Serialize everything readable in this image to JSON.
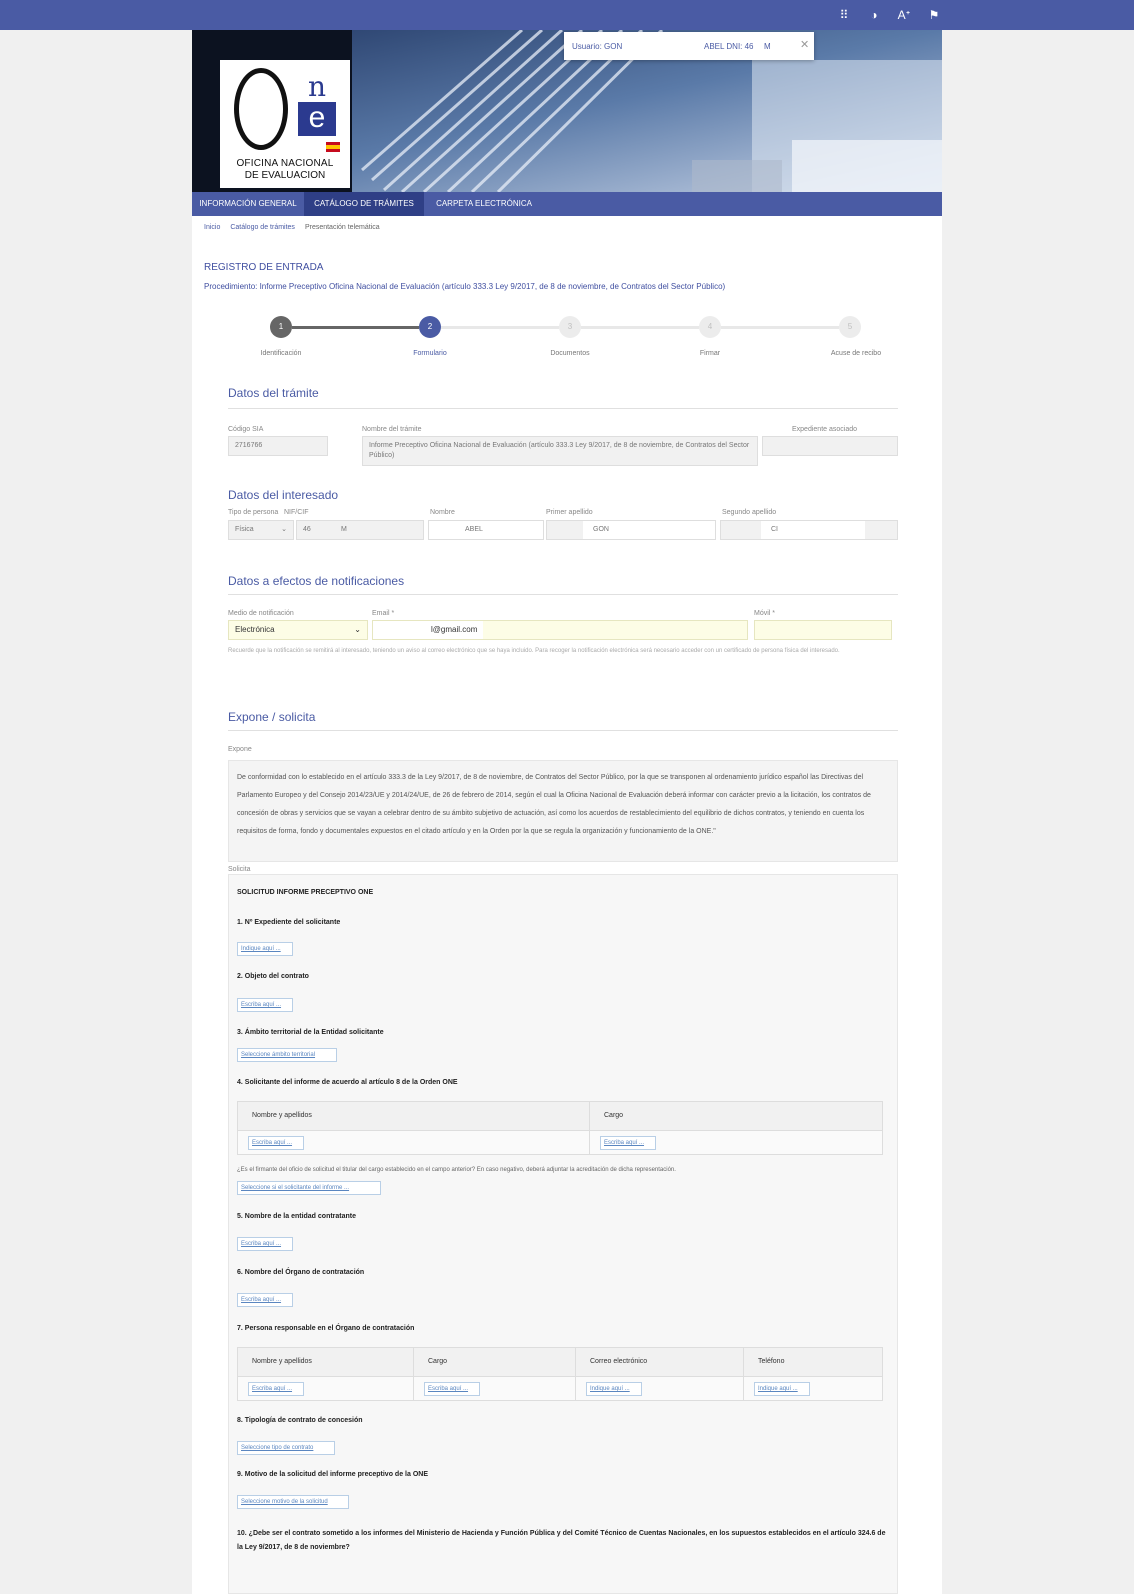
{
  "topbar": {
    "icons": [
      "grid-icon",
      "contrast-icon",
      "font-size-icon",
      "flag-icon"
    ]
  },
  "logo": {
    "line1": "OFICINA NACIONAL",
    "line2": "DE EVALUACION"
  },
  "user": {
    "label": "Usuario: GON",
    "name": "ABEL DNI: 46",
    "suffix": "M"
  },
  "nav": {
    "tab1": "INFORMACIÓN GENERAL",
    "tab2": "CATÁLOGO DE TRÁMITES",
    "tab3": "CARPETA ELECTRÓNICA"
  },
  "breadcrumb": {
    "b1": "Inicio",
    "b2": "Catálogo de trámites",
    "b3": "Presentación telemática"
  },
  "header": {
    "title": "REGISTRO DE ENTRADA",
    "procedure": "Procedimiento: Informe Preceptivo Oficina Nacional de Evaluación (artículo 333.3 Ley 9/2017, de 8 de noviembre, de Contratos del Sector Público)"
  },
  "steps": [
    {
      "num": "1",
      "label": "Identificación"
    },
    {
      "num": "2",
      "label": "Formulario"
    },
    {
      "num": "3",
      "label": "Documentos"
    },
    {
      "num": "4",
      "label": "Firmar"
    },
    {
      "num": "5",
      "label": "Acuse de recibo"
    }
  ],
  "tramite": {
    "title": "Datos del trámite",
    "sia_label": "Código SIA",
    "sia_value": "2716766",
    "name_label": "Nombre del trámite",
    "name_value": "Informe Preceptivo Oficina Nacional de Evaluación (artículo 333.3 Ley 9/2017, de 8 de noviembre, de Contratos del Sector Público)",
    "exp_label": "Expediente asociado"
  },
  "interesado": {
    "title": "Datos del interesado",
    "tipo_label": "Tipo de persona",
    "tipo_value": "Física",
    "nif_label": "NIF/CIF",
    "nif_value": "46",
    "nif_suffix": "M",
    "nombre_label": "Nombre",
    "nombre_value": "ABEL",
    "ap1_label": "Primer apellido",
    "ap1_value": "GON",
    "ap2_label": "Segundo apellido",
    "ap2_value": "CI"
  },
  "notif": {
    "title": "Datos a efectos de notificaciones",
    "medio_label": "Medio de notificación",
    "medio_value": "Electrónica",
    "email_label": "Email *",
    "email_value": "l@gmail.com",
    "movil_label": "Móvil *",
    "note": "Recuerde que la notificación se remitirá al interesado, teniendo un aviso al correo electrónico que se haya incluido. Para recoger la notificación electrónica será necesario acceder con un certificado de persona física del interesado."
  },
  "expone": {
    "title": "Expone / solicita",
    "expone_label": "Expone",
    "expone_text": "De conformidad con lo establecido en el artículo 333.3 de la Ley 9/2017, de 8 de noviembre, de Contratos del Sector Público, por la que se transponen al ordenamiento jurídico español las Directivas del Parlamento Europeo y del Consejo 2014/23/UE y 2014/24/UE, de 26 de febrero de 2014, según el cual la Oficina Nacional de Evaluación deberá informar con carácter previo a la licitación, los contratos de concesión de obras y servicios que se vayan a celebrar dentro de su ámbito subjetivo de actuación, así como los acuerdos de restablecimiento del equilibrio de dichos contratos, y teniendo en cuenta los requisitos de forma, fondo y documentales expuestos en el citado artículo y en la Orden por la que se regula la organización y funcionamiento de la ONE.\"",
    "solicita_label": "Solicita"
  },
  "solicita": {
    "heading": "SOLICITUD INFORME PRECEPTIVO ONE",
    "q1": "1. Nº Expediente del solicitante",
    "f1": "Indique aquí ...",
    "q2": "2. Objeto del contrato",
    "f2": "Escriba aquí ...",
    "q3": "3. Ámbito territorial de la Entidad solicitante",
    "f3": "Seleccione ámbito territorial",
    "q4": "4. Solicitante del informe de acuerdo al artículo 8 de la Orden ONE",
    "t4_h1": "Nombre y apellidos",
    "t4_h2": "Cargo",
    "t4_f1": "Escriba aquí ...",
    "t4_f2": "Escriba aquí ...",
    "q4b": "¿Es el firmante del oficio de solicitud el titular del cargo establecido en el campo anterior? En caso negativo, deberá adjuntar la acreditación de dicha representación.",
    "f4b": "Seleccione si el solicitante del informe ...",
    "q5": "5. Nombre de la entidad contratante",
    "f5": "Escriba aquí ...",
    "q6": "6. Nombre del Órgano de contratación",
    "f6": "Escriba aquí ...",
    "q7": "7. Persona responsable en el Órgano de contratación",
    "t7_h1": "Nombre y apellidos",
    "t7_h2": "Cargo",
    "t7_h3": "Correo electrónico",
    "t7_h4": "Teléfono",
    "t7_f1": "Escriba aquí ...",
    "t7_f2": "Escriba aquí ...",
    "t7_f3": "Indique aquí ...",
    "t7_f4": "Indique aquí ...",
    "q8": "8. Tipología de contrato de concesión",
    "f8": "Seleccione tipo de contrato",
    "q9": "9. Motivo de la solicitud del informe preceptivo de la ONE",
    "f9": "Seleccione motivo de la solicitud",
    "q10": "10. ¿Debe ser el contrato sometido a los informes del Ministerio de Hacienda y Función Pública y del Comité Técnico de Cuentas Nacionales, en los supuestos establecidos en el artículo 324.6 de la Ley 9/2017, de 8 de noviembre?"
  },
  "colors": {
    "brand": "#4a5ba4",
    "nav_active": "#2f3f86",
    "field_yellow": "#fdfde6"
  }
}
